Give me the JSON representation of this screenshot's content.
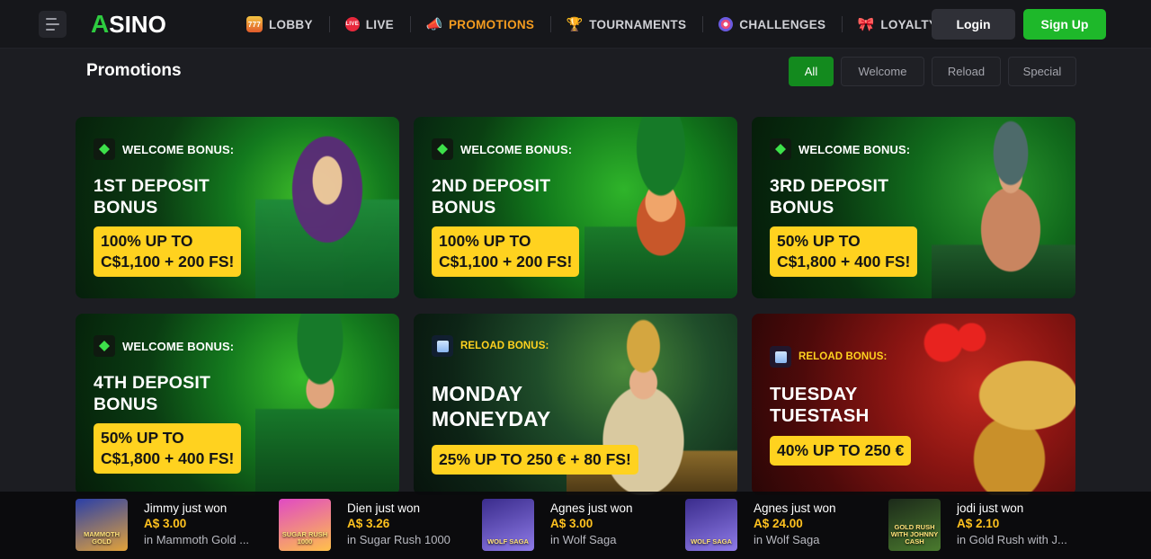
{
  "brand": {
    "logo_mark": "A",
    "logo_text": "SINO"
  },
  "nav": [
    {
      "label": "LOBBY",
      "icon": "slot-777-icon",
      "icon_glyph": "777"
    },
    {
      "label": "LIVE",
      "icon": "live-icon",
      "icon_glyph": "LIVE"
    },
    {
      "label": "PROMOTIONS",
      "icon": "megaphone-icon",
      "icon_glyph": "📣"
    },
    {
      "label": "TOURNAMENTS",
      "icon": "trophy-icon",
      "icon_glyph": "🏆"
    },
    {
      "label": "CHALLENGES",
      "icon": "target-icon",
      "icon_glyph": ""
    },
    {
      "label": "LOYALTY",
      "icon": "ribbon-gift-icon",
      "icon_glyph": "🎀"
    }
  ],
  "auth": {
    "login": "Login",
    "signup": "Sign Up"
  },
  "page_title": "Promotions",
  "filters": [
    "All",
    "Welcome",
    "Reload",
    "Special"
  ],
  "active_filter": "All",
  "promos": [
    {
      "badge": "WELCOME BONUS:",
      "title": "1ST DEPOSIT\nBONUS",
      "offer": "100% UP TO\nC$1,100 + 200 FS!"
    },
    {
      "badge": "WELCOME BONUS:",
      "title": "2ND DEPOSIT\nBONUS",
      "offer": "100% UP TO\nC$1,100 + 200 FS!"
    },
    {
      "badge": "WELCOME BONUS:",
      "title": "3RD DEPOSIT\nBONUS",
      "offer": "50% UP TO\nC$1,800 + 400 FS!"
    },
    {
      "badge": "WELCOME BONUS:",
      "title": "4TH DEPOSIT\nBONUS",
      "offer": "50% UP TO\nC$1,800 + 400 FS!"
    },
    {
      "badge": "RELOAD BONUS:",
      "title": "MONDAY\nMONEYDAY",
      "offer": "25% UP TO 250 € + 80 FS!"
    },
    {
      "badge": "RELOAD BONUS:",
      "title": "TUESDAY\nTUESTASH",
      "offer": "40% UP TO 250 €"
    }
  ],
  "wins": [
    {
      "name": "Jimmy just won",
      "amount": "A$ 3.00",
      "game": "in Mammoth Gold ...",
      "thumb_label": "MAMMOTH GOLD",
      "colors": [
        "#2a3fa8",
        "#e2a23a"
      ]
    },
    {
      "name": "Dien just won",
      "amount": "A$ 3.26",
      "game": "in Sugar Rush 1000",
      "thumb_label": "SUGAR RUSH 1000",
      "colors": [
        "#e04ac4",
        "#ffc14a"
      ]
    },
    {
      "name": "Agnes just won",
      "amount": "A$ 3.00",
      "game": "in Wolf Saga",
      "thumb_label": "WOLF SAGA",
      "colors": [
        "#3a2c8c",
        "#8f7be8"
      ]
    },
    {
      "name": "Agnes just won",
      "amount": "A$ 24.00",
      "game": "in Wolf Saga",
      "thumb_label": "WOLF SAGA",
      "colors": [
        "#3a2c8c",
        "#8f7be8"
      ]
    },
    {
      "name": "jodi just won",
      "amount": "A$ 2.10",
      "game": "in Gold Rush with J...",
      "thumb_label": "GOLD RUSH WITH JOHNNY CASH",
      "colors": [
        "#1c2a1a",
        "#4a7a2e"
      ]
    }
  ]
}
